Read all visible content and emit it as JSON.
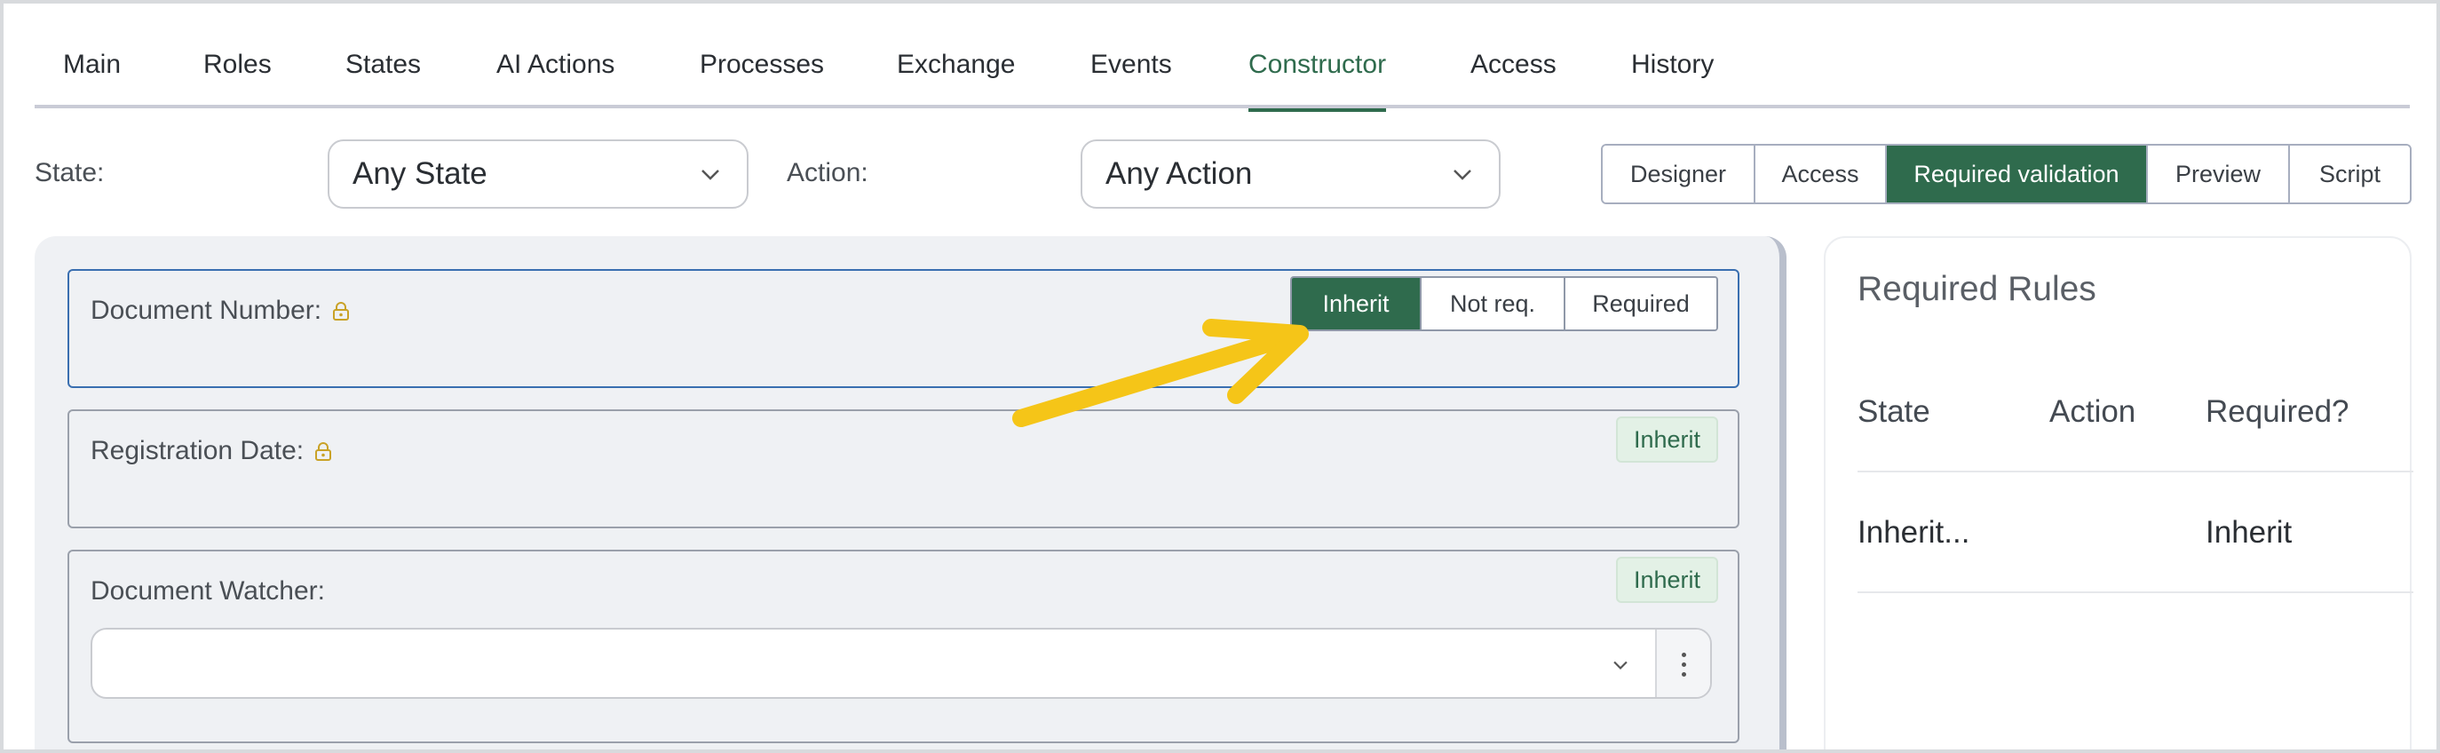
{
  "tabs": [
    {
      "label": "Main"
    },
    {
      "label": "Roles"
    },
    {
      "label": "States"
    },
    {
      "label": "AI Actions"
    },
    {
      "label": "Processes"
    },
    {
      "label": "Exchange"
    },
    {
      "label": "Events"
    },
    {
      "label": "Constructor"
    },
    {
      "label": "Access"
    },
    {
      "label": "History"
    }
  ],
  "active_tab": "Constructor",
  "filters": {
    "state_label": "State:",
    "state_value": "Any State",
    "action_label": "Action:",
    "action_value": "Any Action"
  },
  "modes": [
    {
      "label": "Designer"
    },
    {
      "label": "Access"
    },
    {
      "label": "Required validation"
    },
    {
      "label": "Preview"
    },
    {
      "label": "Script"
    }
  ],
  "active_mode": "Required validation",
  "fields": [
    {
      "label": "Document Number:",
      "locked": true,
      "requirement_options": [
        "Inherit",
        "Not req.",
        "Required"
      ],
      "selected": "Inherit"
    },
    {
      "label": "Registration Date:",
      "locked": true,
      "badge": "Inherit"
    },
    {
      "label": "Document Watcher:",
      "locked": false,
      "badge": "Inherit",
      "select_value": ""
    }
  ],
  "required_rules": {
    "title": "Required Rules",
    "columns": [
      "State",
      "Action",
      "Required?"
    ],
    "rows": [
      {
        "state": "Inherit...",
        "action": "",
        "required": "Inherit"
      }
    ]
  },
  "colors": {
    "accent": "#2f6b4d",
    "focus_border": "#3a6fb0",
    "badge_bg": "#e3f1e6",
    "lock_icon": "#c9a227",
    "annotation_arrow": "#f5c518"
  },
  "icons": {
    "lock": "lock-icon",
    "chevron": "chevron-down-icon",
    "more": "more-vertical-icon",
    "annotation": "arrow-annotation-icon"
  }
}
